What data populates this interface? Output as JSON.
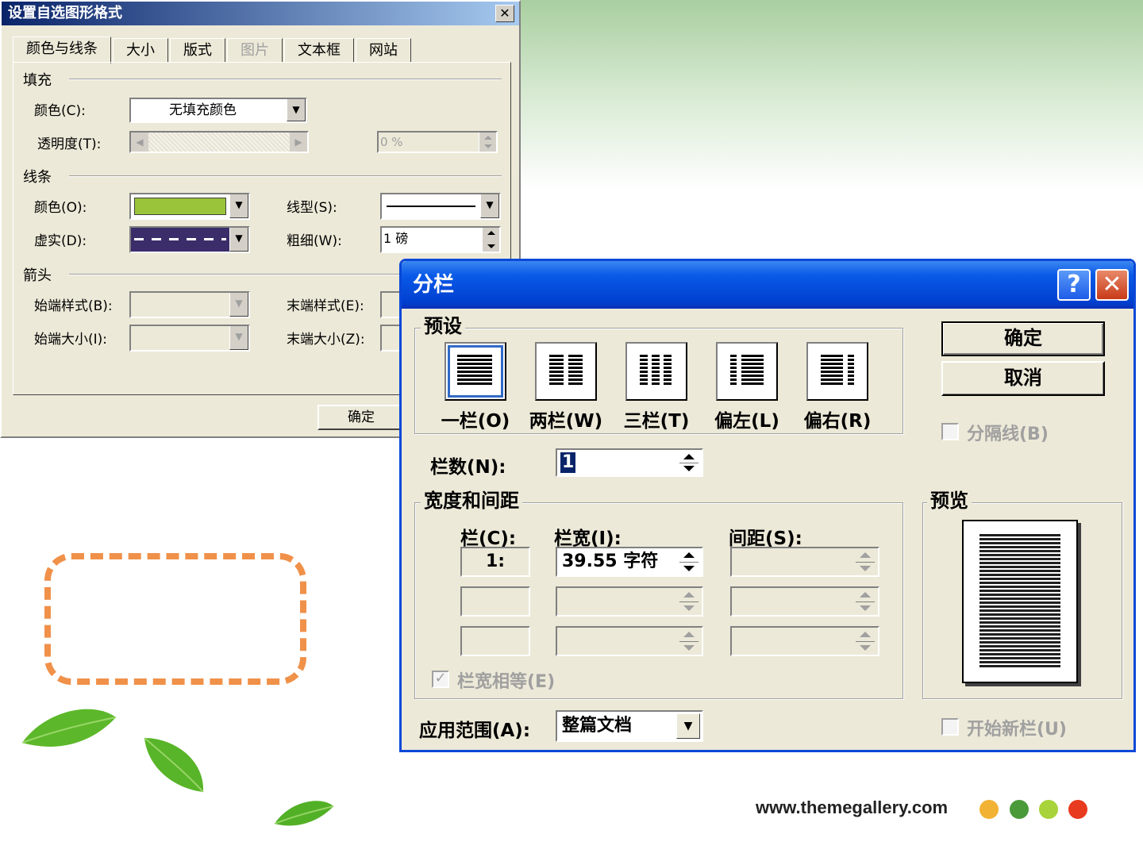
{
  "format_dialog": {
    "title": "设置自选图形格式",
    "close_glyph": "✕",
    "tabs": [
      "颜色与线条",
      "大小",
      "版式",
      "图片",
      "文本框",
      "网站"
    ],
    "fill_group": "填充",
    "fill_color_label": "颜色(C):",
    "fill_color_value": "无填充颜色",
    "transparency_label": "透明度(T):",
    "transparency_value": "0 %",
    "line_group": "线条",
    "line_color_label": "颜色(O):",
    "line_style_label": "线型(S):",
    "dash_label": "虚实(D):",
    "weight_label": "粗细(W):",
    "weight_value": "1 磅",
    "arrow_group": "箭头",
    "begin_style_label": "始端样式(B):",
    "end_style_label": "末端样式(E):",
    "begin_size_label": "始端大小(I):",
    "end_size_label": "末端大小(Z):",
    "ok_label": "确定",
    "line_color_hex": "#9ac43a",
    "dash_bg_hex": "#3b2d6a"
  },
  "columns_dialog": {
    "title": "分栏",
    "help_glyph": "?",
    "close_glyph": "✕",
    "presets_group": "预设",
    "presets": [
      "一栏(O)",
      "两栏(W)",
      "三栏(T)",
      "偏左(L)",
      "偏右(R)"
    ],
    "ok_label": "确定",
    "cancel_label": "取消",
    "separator_label": "分隔线(B)",
    "num_columns_label": "栏数(N):",
    "num_columns_value": "1",
    "width_spacing_group": "宽度和间距",
    "col_header": "栏(C):",
    "width_header": "栏宽(I):",
    "spacing_header": "间距(S):",
    "row1_col": "1:",
    "row1_width": "39.55 字符",
    "equal_width_label": "栏宽相等(E)",
    "preview_group": "预览",
    "apply_label": "应用范围(A):",
    "apply_value": "整篇文档",
    "start_new_label": "开始新栏(U)"
  },
  "slide": {
    "footer_url": "www.themegallery.com",
    "dot_colors": [
      "#f2b233",
      "#4a9a3a",
      "#a8d33a",
      "#e83a1e"
    ],
    "dash_color": "#f0914a"
  }
}
